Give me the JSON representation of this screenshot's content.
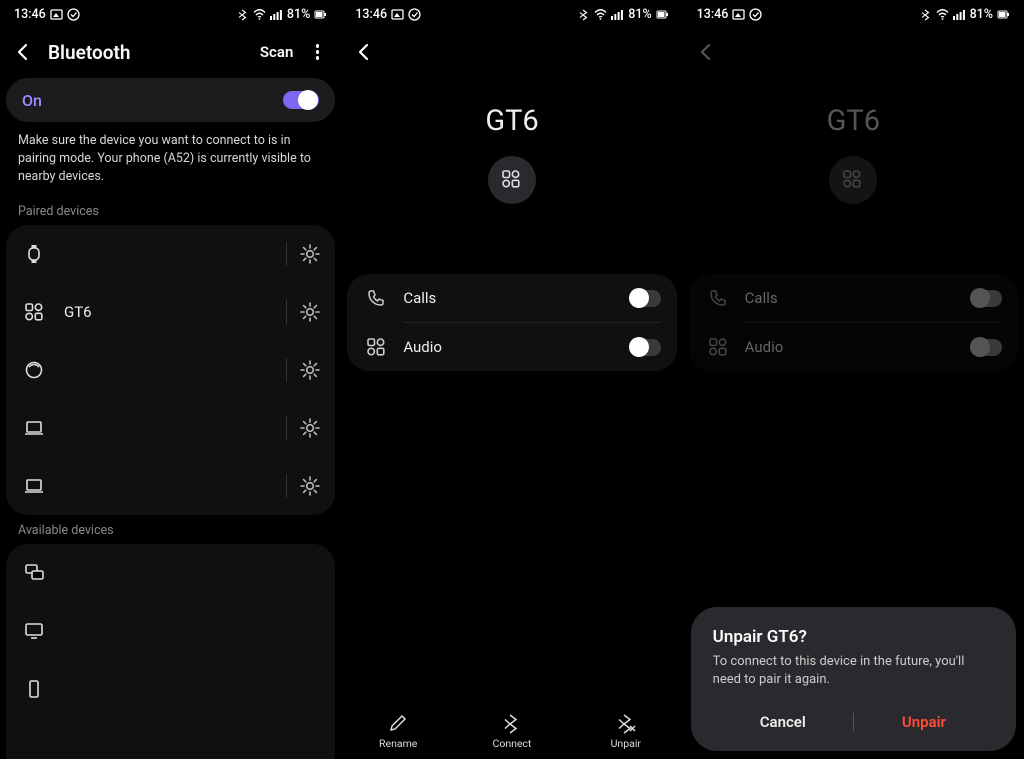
{
  "status": {
    "time": "13:46",
    "battery": "81%"
  },
  "screen1": {
    "title": "Bluetooth",
    "scan": "Scan",
    "on_label": "On",
    "info": "Make sure the device you want to connect to is in pairing mode. Your phone (A52) is currently visible to nearby devices.",
    "paired_label": "Paired devices",
    "paired": [
      {
        "icon": "watch",
        "name": ""
      },
      {
        "icon": "widget",
        "name": "GT6"
      },
      {
        "icon": "circle",
        "name": ""
      },
      {
        "icon": "laptop",
        "name": ""
      },
      {
        "icon": "laptop",
        "name": ""
      }
    ],
    "avail_label": "Available devices"
  },
  "screen2": {
    "device": "GT6",
    "features": [
      {
        "icon": "phone",
        "label": "Calls"
      },
      {
        "icon": "audio",
        "label": "Audio"
      }
    ],
    "actions": {
      "rename": "Rename",
      "connect": "Connect",
      "unpair": "Unpair"
    }
  },
  "screen3": {
    "device": "GT6",
    "features": [
      {
        "icon": "phone",
        "label": "Calls"
      },
      {
        "icon": "audio",
        "label": "Audio"
      }
    ],
    "dialog": {
      "title": "Unpair GT6?",
      "text": "To connect to this device in the future, you'll need to pair it again.",
      "cancel": "Cancel",
      "unpair": "Unpair"
    }
  }
}
